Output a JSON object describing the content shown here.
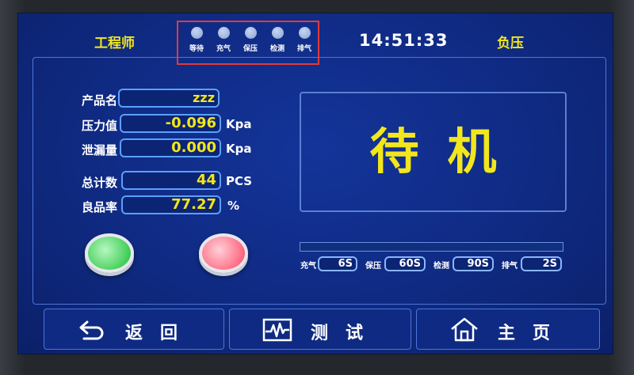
{
  "header": {
    "user": "工程师",
    "time": "14:51:33",
    "mode": "负压",
    "leds": [
      {
        "label": "等待"
      },
      {
        "label": "充气"
      },
      {
        "label": "保压"
      },
      {
        "label": "检测"
      },
      {
        "label": "排气"
      }
    ]
  },
  "readings": {
    "product_label": "产品名",
    "product_value": "zzz",
    "pressure_label": "压力值",
    "pressure_value": "-0.096",
    "pressure_unit": "Kpa",
    "leak_label": "泄漏量",
    "leak_value": "0.000",
    "leak_unit": "Kpa",
    "total_label": "总计数",
    "total_value": "44",
    "total_unit": "PCS",
    "yield_label": "良品率",
    "yield_value": "77.27",
    "yield_unit": "%"
  },
  "status": {
    "text": "待机",
    "progress_fraction": 0.0
  },
  "timers": [
    {
      "label": "充气",
      "value": "6S"
    },
    {
      "label": "保压",
      "value": "60S"
    },
    {
      "label": "检测",
      "value": "90S"
    },
    {
      "label": "排气",
      "value": "2S"
    }
  ],
  "nav": {
    "back": "返回",
    "test": "测试",
    "home": "主页"
  },
  "colors": {
    "accent_yellow": "#f2e61c",
    "panel_blue": "#0f2a82",
    "ok_green": "#46d05c",
    "ng_red": "#ff6f86",
    "highlight_red": "#e23a3a"
  }
}
